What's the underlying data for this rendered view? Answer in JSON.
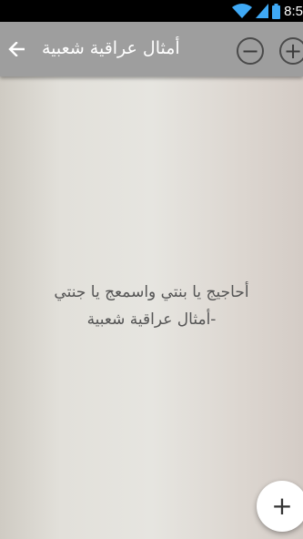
{
  "status_bar": {
    "time": "8:5",
    "icons": [
      "wifi-icon",
      "signal-icon",
      "battery-icon"
    ]
  },
  "app_bar": {
    "title": "أمثال عراقية شعبية",
    "back_icon": "arrow-back-icon",
    "zoom_out_label": "−",
    "zoom_in_label": "+"
  },
  "content": {
    "proverb_line1": "أحاجيج يا بنتي واسمعج يا جنتي",
    "proverb_line2": "-أمثال عراقية شعبية"
  },
  "fab": {
    "label": "+"
  },
  "colors": {
    "app_bar": "#9e9e9e",
    "text": "#555555"
  }
}
